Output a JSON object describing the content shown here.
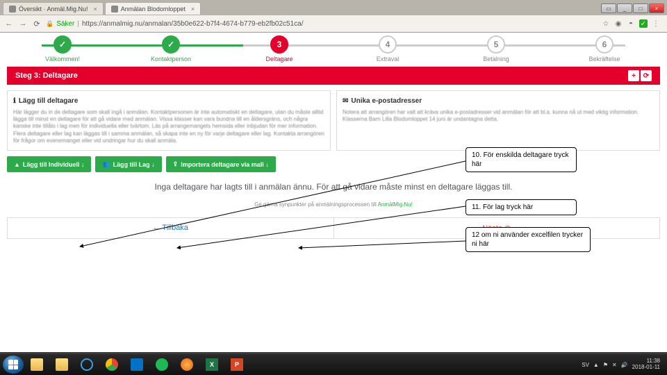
{
  "browser": {
    "tabs": [
      {
        "title": "Översikt · Anmäl.Mig.Nu!"
      },
      {
        "title": "Anmälan Blodomloppet"
      }
    ],
    "secure_label": "Säker",
    "url": "https://anmalmig.nu/anmalan/35b0e622-b7f4-4674-b779-eb2fb02c51ca/"
  },
  "stepper": {
    "steps": [
      {
        "label": "Välkommen!",
        "state": "done",
        "mark": "✓"
      },
      {
        "label": "Kontaktperson",
        "state": "done",
        "mark": "✓"
      },
      {
        "label": "Deltagare",
        "state": "current",
        "mark": "3"
      },
      {
        "label": "Extraval",
        "state": "",
        "mark": "4"
      },
      {
        "label": "Betalning",
        "state": "",
        "mark": "5"
      },
      {
        "label": "Bekräftelse",
        "state": "",
        "mark": "6"
      }
    ]
  },
  "redbar": {
    "title": "Steg 3: Deltagare"
  },
  "panel_left": {
    "heading": "Lägg till deltagare",
    "body": "Här lägger du in de deltagare som skall ingå i anmälan. Kontaktpersonen är inte automatiskt en deltagare, utan du måste alltid lägga till minst en deltagare för att gå vidare med anmälan. Vissa klasser kan vara bundna till en åldersgräns, och några kanske inte tillåts i lag men för individuella eller tvärtom. Läs på arrangemangets hemsida eller inbjudan för mer information. Flera deltagare eller lag kan läggas till i samma anmälan, så skapa inte en ny för varje deltagare eller lag. Kontakta arrangören för frågor om evenemanget eller vid undringar hur du skall anmäla."
  },
  "panel_right": {
    "heading": "Unika e-postadresser",
    "body": "Notera att arrangören har valt att kräva unika e-postadresser vid anmälan för att bl.a. kunna nå ut med viktig information. Klasserna Barn Lilla Blodomloppet 14 juni är undantagna detta."
  },
  "buttons": {
    "individual": "Lägg till Individuell ↓",
    "team": "Lägg till Lag ↓",
    "import": "Importera deltagare via mall ↓"
  },
  "messages": {
    "empty": "Inga deltagare har lagts till i anmälan ännu. För att gå vidare måste minst en deltagare läggas till.",
    "feedback_pre": "Ge gärna synpunkter på anmälningsprocessen till ",
    "feedback_link": "AnmälMig.Nu!"
  },
  "nav": {
    "back": "Tillbaka",
    "next": "Nästa"
  },
  "callouts": {
    "c1": "10. För enskilda deltagare tryck här",
    "c2": "11. För lag tryck här",
    "c3": "12 om ni använder excelfilen trycker ni här"
  },
  "tray": {
    "lang": "SV",
    "time": "11:38",
    "date": "2018-01-11"
  }
}
